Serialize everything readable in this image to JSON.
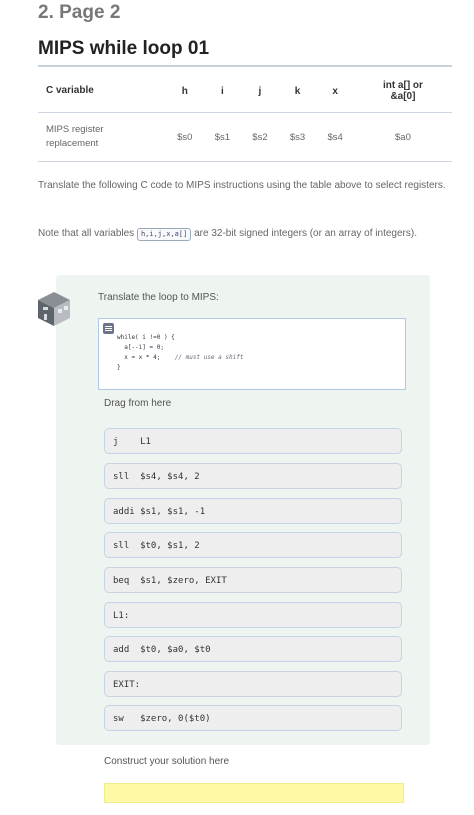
{
  "page": {
    "header": "2. Page 2",
    "title": "MIPS while loop 01"
  },
  "table": {
    "header": [
      "C variable",
      "h",
      "i",
      "j",
      "k",
      "x",
      "int a[] or",
      "&a[0]"
    ],
    "row_label": [
      "MIPS register",
      "replacement"
    ],
    "row_values": [
      "$s0",
      "$s1",
      "$s2",
      "$s3",
      "$s4",
      "$a0"
    ]
  },
  "instructions": {
    "p1": "Translate the following C code to MIPS instructions using the table above to select registers.",
    "p2_before": "Note that all variables ",
    "p2_code": "h,i,j,x,a[]",
    "p2_after": " are 32-bit signed integers (or an array of integers)."
  },
  "exercise": {
    "prompt": "Translate the loop to MIPS:",
    "code_lines": [
      "while( i !=0 ) {",
      "  a[--i] = 0;",
      "  x = x * 4;"
    ],
    "code_comment": "// must use a shift",
    "code_close": "}",
    "drag_label": "Drag from here",
    "blocks": [
      "j    L1",
      "sll  $s4, $s4, 2",
      "addi $s1, $s1, -1",
      "sll  $t0, $s1, 2",
      "beq  $s1, $zero, EXIT",
      "L1:",
      "add  $t0, $a0, $t0",
      "EXIT:",
      "sw   $zero, 0($t0)"
    ],
    "construct_label": "Construct your solution here"
  },
  "colors": {
    "panel_bg": "#eef4ef",
    "block_border": "#c9d1e5",
    "dropzone": "#fdf9a6",
    "code_border": "#b3c8e6"
  },
  "icons": {
    "exercise": "robot-icon",
    "code": "code-block-icon"
  }
}
